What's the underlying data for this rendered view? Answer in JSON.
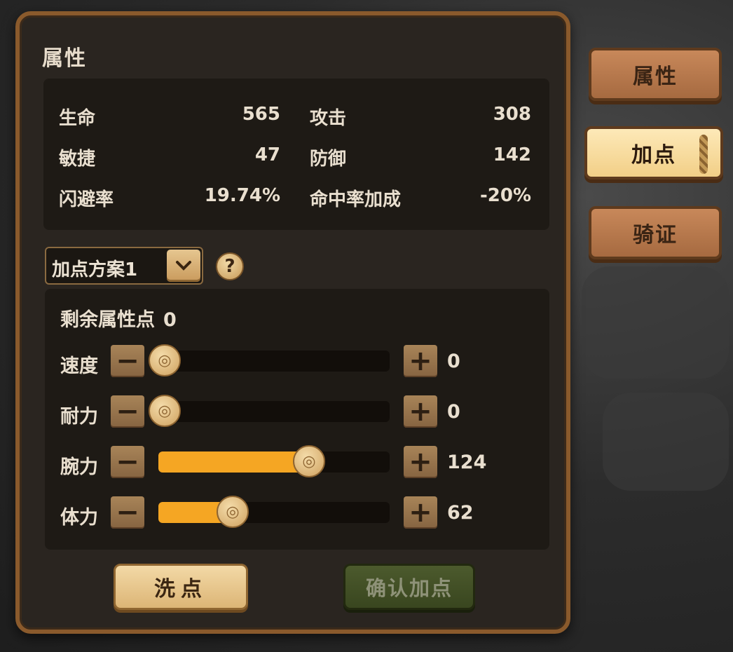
{
  "panel": {
    "title": "属性"
  },
  "stats": [
    {
      "label": "生命",
      "value": "565"
    },
    {
      "label": "攻击",
      "value": "308"
    },
    {
      "label": "敏捷",
      "value": "47"
    },
    {
      "label": "防御",
      "value": "142"
    },
    {
      "label": "闪避率",
      "value": "19.74%"
    },
    {
      "label": "命中率加成",
      "value": "-20%"
    }
  ],
  "plan": {
    "selected": "加点方案1",
    "help_icon": "?",
    "dropdown_icon": "chevron-down-icon"
  },
  "points": {
    "remaining_label": "剩余属性点",
    "remaining_value": "0",
    "attributes": [
      {
        "label": "速度",
        "value": "0",
        "fill_fraction": 0.0
      },
      {
        "label": "耐力",
        "value": "0",
        "fill_fraction": 0.0
      },
      {
        "label": "腕力",
        "value": "124",
        "fill_fraction": 0.65
      },
      {
        "label": "体力",
        "value": "62",
        "fill_fraction": 0.32
      }
    ],
    "minus_symbol": "−",
    "plus_symbol": "+",
    "knob_glyph": "◎"
  },
  "buttons": {
    "reset": "洗点",
    "confirm": "确认加点"
  },
  "tabs": [
    {
      "label": "属性",
      "active": false
    },
    {
      "label": "加点",
      "active": true
    },
    {
      "label": "骑证",
      "active": false
    }
  ],
  "colors": {
    "fill": "#f5a623",
    "panel_border": "#8a5a2c",
    "active_tab": "#f2cf87"
  }
}
